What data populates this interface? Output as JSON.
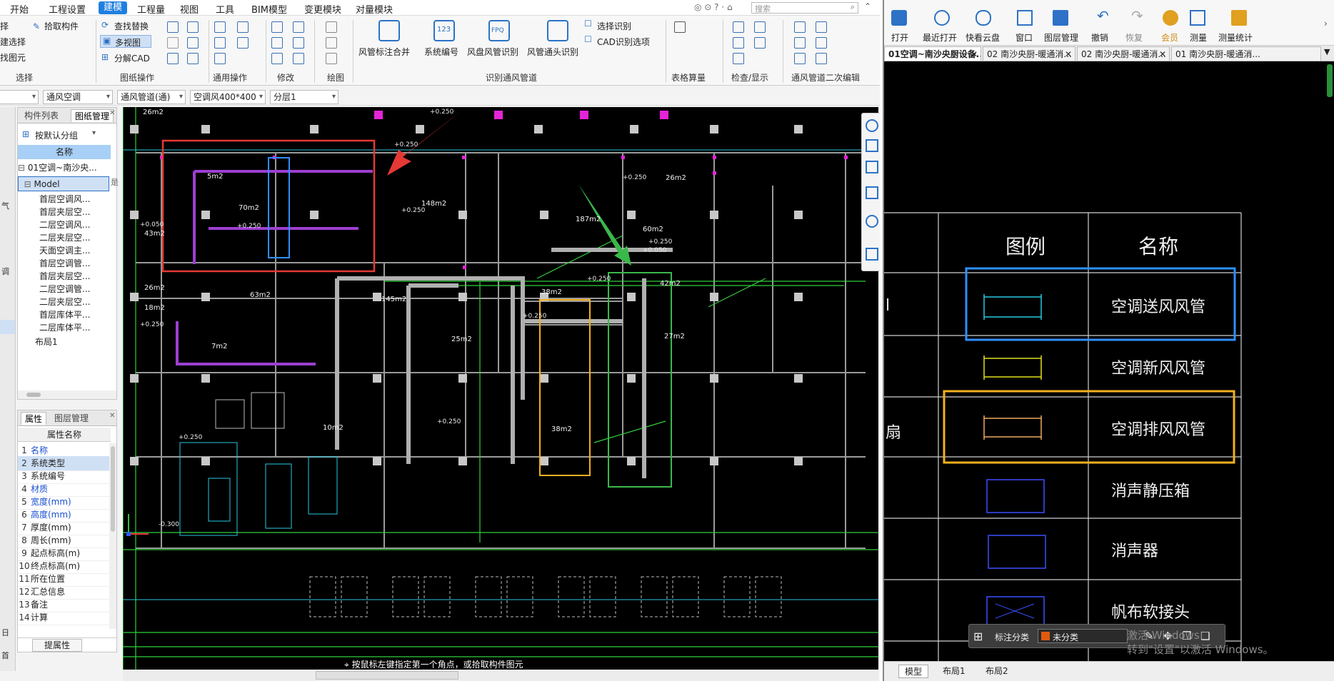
{
  "left_app": {
    "menu": [
      "开始",
      "工程设置",
      "建模",
      "工程量",
      "视图",
      "工具",
      "BIM模型",
      "变更模块",
      "对量模块"
    ],
    "active_menu": "建模",
    "search_placeholder": "搜索",
    "ribbon": {
      "left_cut": [
        "择",
        "建选择",
        "找图元"
      ],
      "pick_component": "拾取构件",
      "find_replace": "查找替换",
      "multi_view": "多视图",
      "decompose_cad": "分解CAD",
      "groups": [
        "选择",
        "图纸操作",
        "通用操作",
        "修改",
        "绘图",
        "识别通风管道",
        "表格算量",
        "检查/显示",
        "通风管道二次编辑"
      ],
      "big_buttons": [
        "风管标注合并",
        "系统编号",
        "风盘风管识别",
        "风管通头识别"
      ],
      "select_identify": "选择识别",
      "cad_identify_options": "CAD识别选项"
    },
    "filter": [
      "通风空调",
      "通风管道(通)",
      "空调风400*400",
      "分层1"
    ],
    "strip_labels": [
      "气",
      "调",
      "日",
      "首"
    ],
    "component_panel": {
      "tabs": [
        "构件列表",
        "图纸管理"
      ],
      "group_by": "按默认分组",
      "column": "名称",
      "file": "01空调~南沙央...",
      "model": "Model",
      "items": [
        "首层空调风...",
        "首层夹层空...",
        "二层空调风...",
        "二层夹层空...",
        "天面空调主...",
        "首层空调管...",
        "首层夹层空...",
        "二层空调管...",
        "二层夹层空...",
        "首层库体平...",
        "二层库体平..."
      ],
      "layout": "布局1",
      "side_char": "是"
    },
    "property_panel": {
      "tabs": [
        "属性",
        "图层管理"
      ],
      "column": "属性名称",
      "rows": [
        {
          "n": "1",
          "name": "名称",
          "blue": true
        },
        {
          "n": "2",
          "name": "系统类型",
          "blue": false
        },
        {
          "n": "3",
          "name": "系统编号",
          "blue": false
        },
        {
          "n": "4",
          "name": "材质",
          "blue": true
        },
        {
          "n": "5",
          "name": "宽度(mm)",
          "blue": true
        },
        {
          "n": "6",
          "name": "高度(mm)",
          "blue": true
        },
        {
          "n": "7",
          "name": "厚度(mm)",
          "blue": false
        },
        {
          "n": "8",
          "name": "周长(mm)",
          "blue": false
        },
        {
          "n": "9",
          "name": "起点标高(m)",
          "blue": false
        },
        {
          "n": "10",
          "name": "终点标高(m)",
          "blue": false
        },
        {
          "n": "11",
          "name": "所在位置",
          "blue": false
        },
        {
          "n": "12",
          "name": "汇总信息",
          "blue": false
        },
        {
          "n": "13",
          "name": "备注",
          "blue": false
        },
        {
          "n": "14",
          "name": "计算",
          "blue": false
        }
      ],
      "button": "提属性"
    },
    "command_hint": "按鼠标左键指定第一个角点，或拾取构件图元",
    "canvas_labels": {
      "areas": [
        "26m2",
        "5m2",
        "70m2",
        "148m2",
        "187m2",
        "26m2",
        "60m2",
        "43m2",
        "63m2",
        "145m2",
        "38m2",
        "42m2",
        "18m2",
        "7m2",
        "25m2",
        "27m2",
        "10m2",
        "38m2",
        "26m2"
      ],
      "elevations": [
        "+0.250",
        "+0.250",
        "+0.250",
        "+0.050",
        "+0.250",
        "+0.250",
        "+0.250",
        "+0.250",
        "+0.050",
        "+0.250",
        "+0.250",
        "+0.250",
        "+0.250",
        "-0.300"
      ]
    }
  },
  "right_app": {
    "toolbar": [
      "打开",
      "最近打开",
      "快看云盘",
      "窗口",
      "图层管理",
      "撤销",
      "恢复",
      "会员",
      "测量",
      "测量统计"
    ],
    "tabs": [
      "01空调~南沙央厨设备...",
      "02 南沙央厨-暖通消...",
      "02 南沙央厨-暖通消...",
      "01 南沙央厨-暖通消..."
    ],
    "legend": {
      "header_symbol": "图例",
      "header_name": "名称",
      "rows": [
        "空调送风风管",
        "空调新风风管",
        "空调排风风管",
        "消声静压箱",
        "消声器",
        "帆布软接头"
      ],
      "left_cut": [
        "l",
        "扇"
      ]
    },
    "classify_label": "标注分类",
    "classify_value": "未分类",
    "bottom_tabs": [
      "模型",
      "布局1",
      "布局2"
    ],
    "watermark_line1": "激活 Windows",
    "watermark_line2": "转到\"设置\"以激活 Windows。"
  },
  "colors": {
    "accent": "#1f7fe0",
    "cad_bg": "#000000",
    "highlight_red": "#e53935",
    "highlight_blue": "#2f8fff",
    "highlight_yellow": "#f2b01e",
    "highlight_green": "#3bb84a"
  }
}
